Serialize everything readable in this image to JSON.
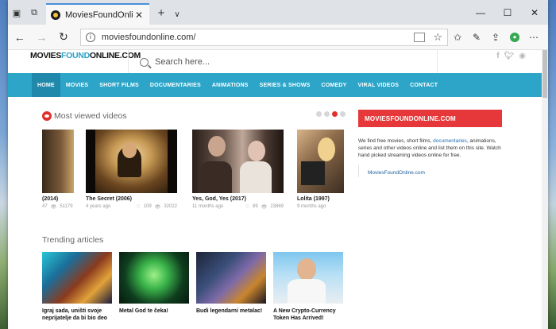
{
  "browser": {
    "tab_title": "MoviesFoundOnline.cor",
    "address": "moviesfoundonline.com/",
    "close_glyph": "✕",
    "new_tab_glyph": "+",
    "tab_menu_glyph": "∨"
  },
  "site": {
    "logo_part1": "MOVIES",
    "logo_part2": "FOUND",
    "logo_part3": "ONLINE.COM",
    "search_placeholder": "Search here...",
    "social": [
      "f",
      "t",
      "rss"
    ]
  },
  "nav": [
    {
      "label": "HOME",
      "active": true
    },
    {
      "label": "MOVIES"
    },
    {
      "label": "SHORT FILMS"
    },
    {
      "label": "DOCUMENTARIES"
    },
    {
      "label": "ANIMATIONS"
    },
    {
      "label": "SERIES & SHOWS"
    },
    {
      "label": "COMEDY"
    },
    {
      "label": "VIRAL VIDEOS"
    },
    {
      "label": "CONTACT"
    }
  ],
  "most_viewed": {
    "title": "Most viewed videos",
    "videos": [
      {
        "title": "(2014)",
        "age": "",
        "likes": "47",
        "views": "51179"
      },
      {
        "title": "The Secret (2006)",
        "age": "4 years ago",
        "likes": "109",
        "views": "32022"
      },
      {
        "title": "Yes, God, Yes (2017)",
        "age": "11 months ago",
        "likes": "89",
        "views": "23869"
      },
      {
        "title": "Lolita (1997)",
        "age": "9 months ago",
        "likes": "",
        "views": ""
      }
    ]
  },
  "trending": {
    "title": "Trending articles",
    "articles": [
      {
        "title": "Igraj sada, uništi svoje neprijatelje da bi bio deo"
      },
      {
        "title": "Metal God te čeka!"
      },
      {
        "title": "Budi legendarni metalac!"
      },
      {
        "title": "A New Crypto-Currency Token Has Arrived!"
      }
    ]
  },
  "sidebar": {
    "title": "MOVIESFOUNDONLINE.COM",
    "text_before": "We find free movies, short films, ",
    "text_link": "documentaries",
    "text_after": ", animations, series and other videos online and list them on this site. Watch hand picked streaming videos online for free.",
    "link": "MoviesFoundOnline.com"
  },
  "colors": {
    "accent_blue": "#2ca5c9",
    "accent_red": "#e6383a"
  }
}
